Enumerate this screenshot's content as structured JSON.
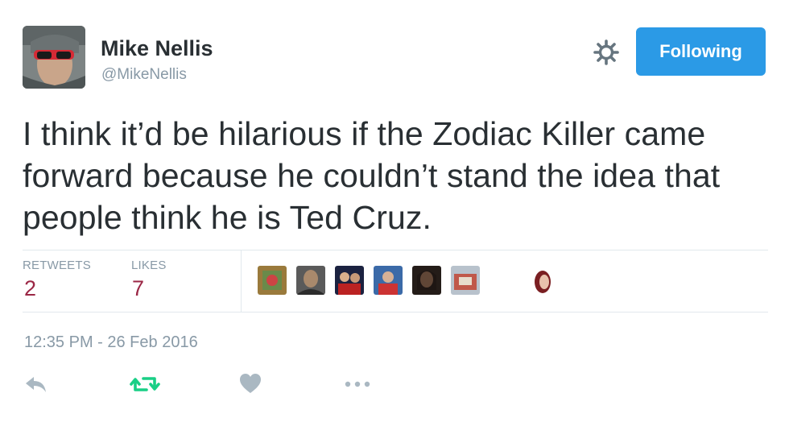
{
  "user": {
    "name": "Mike Nellis",
    "handle": "@MikeNellis"
  },
  "header": {
    "follow_label": "Following",
    "settings_icon": "gear-icon"
  },
  "tweet": {
    "text_lines": [
      "I think it’d be hilarious if the Zodiac Killer came",
      "forward because he couldn’t stand the idea that",
      "people think he is Ted Cruz."
    ],
    "timestamp": "12:35 PM - 26 Feb 2016"
  },
  "stats": {
    "retweets_label": "RETWEETS",
    "retweets_count": "2",
    "likes_label": "LIKES",
    "likes_count": "7"
  },
  "liker_avatars": [
    "liker-1",
    "liker-2",
    "liker-3",
    "liker-4",
    "liker-5",
    "liker-6",
    "liker-7"
  ],
  "actions": [
    "reply-icon",
    "retweet-icon",
    "like-icon",
    "more-icon"
  ],
  "colors": {
    "accent": "#2b9ae6",
    "count": "#9b2745",
    "retweet_green": "#19cf86",
    "muted": "#8899a6"
  }
}
